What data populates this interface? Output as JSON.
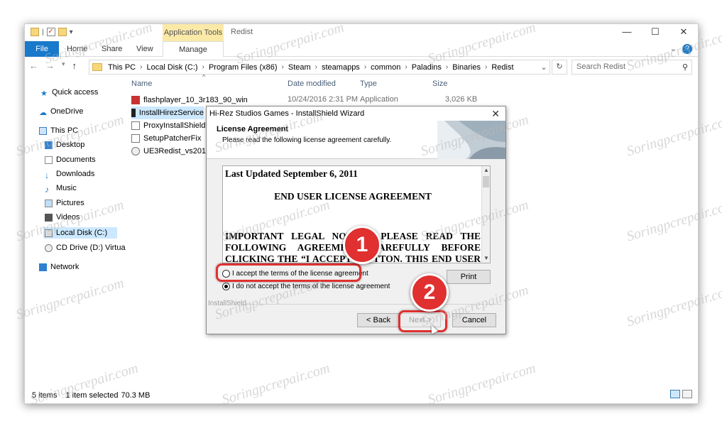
{
  "watermark": "Soringpcrepair.com",
  "titlebar": {
    "context_tab": "Application Tools",
    "title": "Redist",
    "minimize": "—",
    "maximize": "☐",
    "close": "✕"
  },
  "ribbon": {
    "file": "File",
    "home": "Home",
    "share": "Share",
    "view": "View",
    "manage": "Manage",
    "collapse": "⌄",
    "help": "?"
  },
  "address": {
    "crumbs": [
      "This PC",
      "Local Disk (C:)",
      "Program Files (x86)",
      "Steam",
      "steamapps",
      "common",
      "Paladins",
      "Binaries",
      "Redist"
    ],
    "search_placeholder": "Search Redist"
  },
  "nav": {
    "items": [
      "Quick access",
      "OneDrive",
      "This PC",
      "Desktop",
      "Documents",
      "Downloads",
      "Music",
      "Pictures",
      "Videos",
      "Local Disk (C:)",
      "CD Drive (D:) Virtua",
      "Network"
    ]
  },
  "columns": {
    "name": "Name",
    "date": "Date modified",
    "type": "Type",
    "size": "Size"
  },
  "files": [
    {
      "name": "flashplayer_10_3r183_90_win",
      "date": "10/24/2016 2:31 PM",
      "type": "Application",
      "size": "3,026 KB"
    },
    {
      "name": "InstallHirezService"
    },
    {
      "name": "ProxyInstallShield"
    },
    {
      "name": "SetupPatcherFix"
    },
    {
      "name": "UE3Redist_vs2012"
    }
  ],
  "status": {
    "items": "5 items",
    "selected": "1 item selected",
    "size": "70.3 MB"
  },
  "dialog": {
    "title": "Hi-Rez Studios Games - InstallShield Wizard",
    "close": "✕",
    "heading": "License Agreement",
    "subheading": "Please read the following license agreement carefully.",
    "eula_updated": "Last Updated September 6, 2011",
    "eula_title": "END USER LICENSE AGREEMENT",
    "eula_lines": [
      "IMPORTANT LEGAL NOTICE: PLEASE READ THE",
      "FOLLOWING AGREEMENT CAREFULLY BEFORE",
      "CLICKING THE “I ACCEPT” BUTTON. THIS END USER"
    ],
    "accept_label": "I accept the terms of the license agreement",
    "decline_label": "I do not accept the terms of the license agreement",
    "print": "Print",
    "installshield": "InstallShield",
    "back": "< Back",
    "next": "Next >",
    "cancel": "Cancel"
  },
  "annotations": {
    "step1": "1",
    "step2": "2",
    "color": "#e03030"
  }
}
